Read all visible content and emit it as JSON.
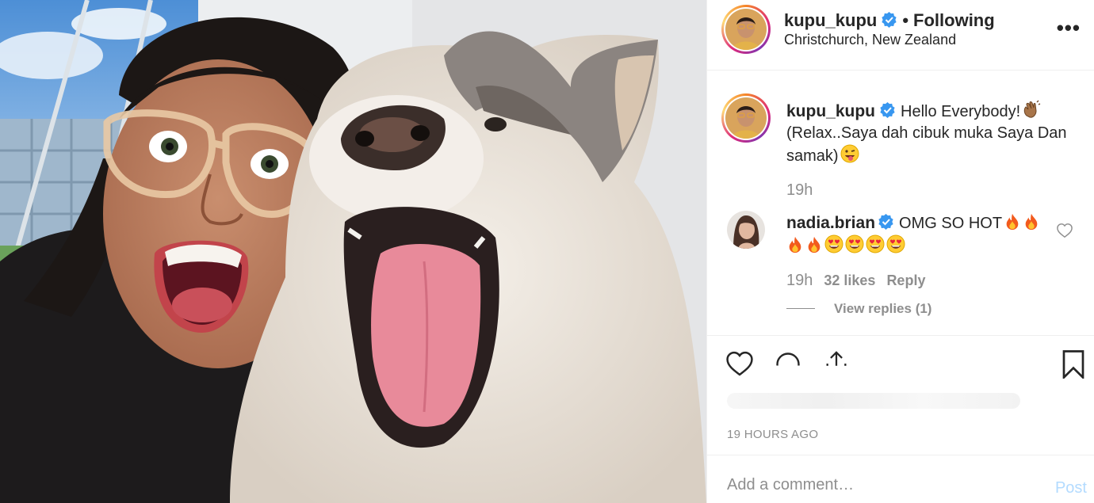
{
  "post": {
    "author": "kupu_kupu",
    "separator": "•",
    "follow_status": "Following",
    "location": "Christchurch, New Zealand",
    "more_icon": "more-options-icon",
    "more_label": "•••"
  },
  "caption": {
    "username": "kupu_kupu",
    "text_line1": "Hello Everybody!",
    "text_line2": "(Relax..Saya dah cibuk muka Saya Dan samak)",
    "emoji_1": "waving-hand",
    "emoji_2": "winking-face-with-tongue",
    "time": "19h"
  },
  "comments": [
    {
      "username": "nadia.brian",
      "text": "OMG SO HOT",
      "emojis": [
        "fire",
        "fire",
        "fire",
        "fire",
        "heart-eyes",
        "heart-eyes",
        "heart-eyes",
        "heart-eyes"
      ],
      "time": "19h",
      "likes": "32 likes",
      "reply_label": "Reply",
      "view_replies": "View replies (1)"
    }
  ],
  "actions": {
    "like_icon": "heart-icon",
    "comment_icon": "comment-icon",
    "share_icon": "share-icon",
    "save_icon": "bookmark-icon"
  },
  "time_ago": "19 HOURS AGO",
  "add_comment": {
    "placeholder": "Add a comment…",
    "post_label": "Post"
  },
  "colors": {
    "verified": "#3897f0",
    "muted": "#8e8e8e",
    "post_disabled": "#b3dbff",
    "text": "#262626"
  }
}
